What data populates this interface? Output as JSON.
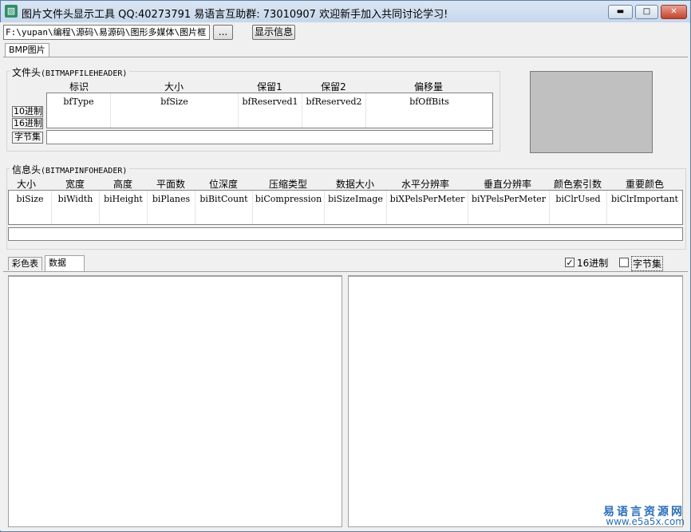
{
  "window": {
    "title": "图片文件头显示工具 QQ:40273791 易语言互助群: 73010907 欢迎新手加入共同讨论学习!",
    "minimize_glyph": "▬",
    "maximize_glyph": "□",
    "close_glyph": "✕"
  },
  "toolbar": {
    "path_value": "F:\\yupan\\编程\\源码\\易源码\\图形多媒体\\图片框",
    "browse_label": "...",
    "show_info_label": "显示信息"
  },
  "tabs": [
    "BMP图片"
  ],
  "file_header": {
    "title_zh": "文件头",
    "title_en": "(BITMAPFILEHEADER)",
    "columns": [
      {
        "label": "标识",
        "field": "bfType"
      },
      {
        "label": "大小",
        "field": "bfSize"
      },
      {
        "label": "保留1",
        "field": "bfReserved1"
      },
      {
        "label": "保留2",
        "field": "bfReserved2"
      },
      {
        "label": "偏移量",
        "field": "bfOffBits"
      }
    ],
    "btn_dec": "10进制",
    "btn_hex": "16进制",
    "btn_bytes": "字节集"
  },
  "info_header": {
    "title_zh": "信息头",
    "title_en": "(BITMAPINFOHEADER)",
    "columns": [
      {
        "label": "大小",
        "field": "biSize"
      },
      {
        "label": "宽度",
        "field": "biWidth"
      },
      {
        "label": "高度",
        "field": "biHeight"
      },
      {
        "label": "平面数",
        "field": "biPlanes"
      },
      {
        "label": "位深度",
        "field": "biBitCount"
      },
      {
        "label": "压缩类型",
        "field": "biCompression"
      },
      {
        "label": "数据大小",
        "field": "biSizeImage"
      },
      {
        "label": "水平分辨率",
        "field": "biXPelsPerMeter"
      },
      {
        "label": "垂直分辨率",
        "field": "biYPelsPerMeter"
      },
      {
        "label": "颜色索引数",
        "field": "biClrUsed"
      },
      {
        "label": "重要颜色",
        "field": "biClrImportant"
      }
    ]
  },
  "data_tabs": [
    "彩色表",
    "数据"
  ],
  "options": {
    "hex_label": "16进制",
    "hex_checked": true,
    "bytes_label": "字节集",
    "bytes_checked": false
  },
  "watermark": {
    "line1": "易语言资源网",
    "line2": "www.e5a5x.com"
  },
  "colors": {
    "preview_fill": "#c0c0c0",
    "watermark": "#2a6fb8"
  }
}
